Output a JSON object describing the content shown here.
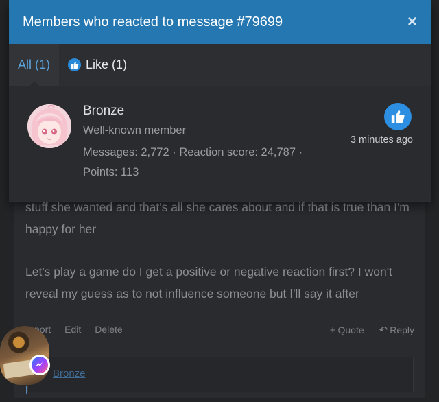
{
  "modal": {
    "title": "Members who reacted to message #79699",
    "close_label": "×",
    "tabs": [
      {
        "label": "All (1)"
      },
      {
        "label": "Like (1)"
      }
    ]
  },
  "member": {
    "name": "Bronze",
    "title": "Well-known member",
    "stats": "Messages: 2,772 · Reaction score: 24,787 · Points: 113",
    "reaction_time": "3 minutes ago"
  },
  "post": {
    "paragraph1": "stuff she wanted and that's all she cares about and if that is true than I'm happy for her",
    "paragraph2": "Let's play a game do I get a positive or negative reaction first? I won't reveal my guess as to not influence someone but I'll say it after",
    "actions_left": [
      "port",
      "Edit",
      "Delete"
    ],
    "actions_right": [
      "Quote",
      "Reply"
    ]
  },
  "reply": {
    "mention": "Bronze"
  },
  "colors": {
    "header": "#2577b1",
    "accent": "#5aa2dc",
    "like_blue": "#2d8fe2"
  }
}
